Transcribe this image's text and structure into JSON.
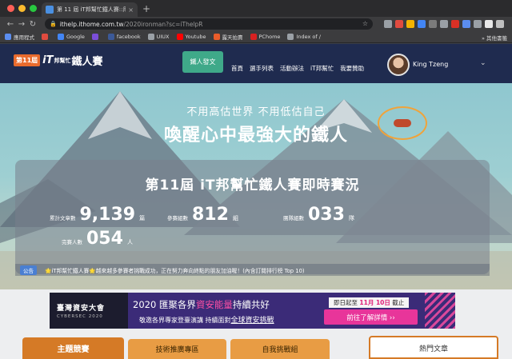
{
  "browser": {
    "tab_title": "第 11 屆 iT邦幫忙鐵人賽::用30天",
    "tab_close": "×",
    "new_tab": "+",
    "url_host": "ithelp.ithome.com.tw",
    "url_path": "/2020ironman?sc=iThelpR",
    "back": "←",
    "forward": "→",
    "reload": "↻",
    "lock": "🔒",
    "star": "☆"
  },
  "bookmarks": {
    "items": [
      {
        "label": "應用程式",
        "color": "#5b8def"
      },
      {
        "label": "",
        "color": "#e04b3f"
      },
      {
        "label": "Google",
        "color": "#4285f4"
      },
      {
        "label": "",
        "color": "#7b4ed8"
      },
      {
        "label": "facebook",
        "color": "#3b5998"
      },
      {
        "label": "UIUX",
        "color": "#9aa0a6"
      },
      {
        "label": "Youtube",
        "color": "#ff0000"
      },
      {
        "label": "露天拍賣",
        "color": "#e95c2a"
      },
      {
        "label": "PChome",
        "color": "#d92121"
      },
      {
        "label": "Index of /",
        "color": "#9aa0a6"
      }
    ],
    "more": "»",
    "other": "其他書籤"
  },
  "site": {
    "logo_badge": "第11屆",
    "logo_it": "iT",
    "logo_sub": "邦幫忙",
    "logo_main": "鐵人賽",
    "signup": "鐵人發文",
    "nav": [
      "首頁",
      "選手列表",
      "活動辦法",
      "iT邦幫忙",
      "我要贊助"
    ],
    "username": "King Tzeng",
    "caret": "⌄"
  },
  "hero": {
    "sub": "不用高估世界 不用低估自己",
    "main": "喚醒心中最強大的鐵人"
  },
  "stats": {
    "title": "第11屆 iT邦幫忙鐵人賽即時賽況",
    "items": [
      {
        "label": "累計文章數",
        "value": "9,139",
        "unit": "篇"
      },
      {
        "label": "參賽組數",
        "value": "812",
        "unit": "組"
      },
      {
        "label": "團隊組數",
        "value": "033",
        "unit": "隊"
      },
      {
        "label": "完賽人數",
        "value": "054",
        "unit": "人"
      }
    ]
  },
  "announce": {
    "tag": "公告",
    "text": "🌟iT邦幫忙鐵人賽🌟越來越多參賽者挑戰成功，正在努力奔向終點的朋友加油喔！(內含訂閱排行榜 Top 10)"
  },
  "banner": {
    "left_title": "臺灣資安大會",
    "left_sub": "CYBERSEC 2020",
    "title_pre": "2020 匯聚各界",
    "title_hl": "資安能量",
    "title_post": "持續共好",
    "desc_pre": "敬邀各界專家登臺演講 持續面對",
    "desc_ul": "全球資安挑戰",
    "date_pre": "即日起至",
    "date_hl": "11月 10日",
    "date_post": "截止",
    "cta": "前往了解詳情 ››"
  },
  "bottom_tabs": [
    "主題競賽",
    "技術推廣專區",
    "自我挑戰組"
  ],
  "hot_articles": "熱門文章"
}
